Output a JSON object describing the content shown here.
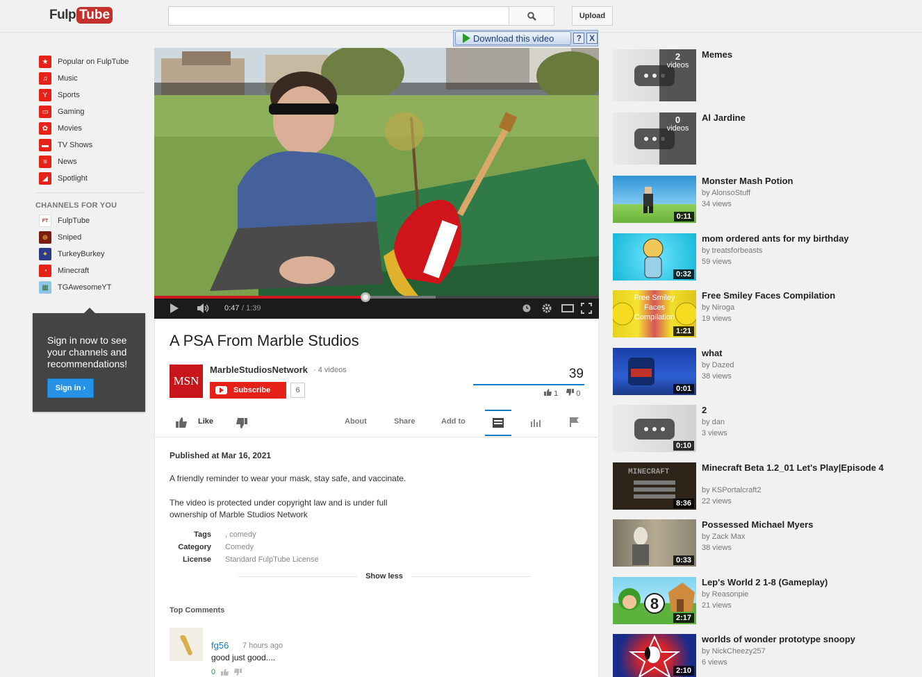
{
  "header": {
    "logo_left": "Fulp",
    "logo_right": "Tube",
    "search_placeholder": "",
    "upload_label": "Upload"
  },
  "download_bar": {
    "label": "Download this video",
    "help": "?",
    "close": "X"
  },
  "guide": {
    "items": [
      {
        "label": "Popular on FulpTube",
        "icon": "star-icon"
      },
      {
        "label": "Music",
        "icon": "headphones-icon"
      },
      {
        "label": "Sports",
        "icon": "trophy-icon"
      },
      {
        "label": "Gaming",
        "icon": "gamepad-icon"
      },
      {
        "label": "Movies",
        "icon": "film-reel-icon"
      },
      {
        "label": "TV Shows",
        "icon": "tv-icon"
      },
      {
        "label": "News",
        "icon": "newspaper-icon"
      },
      {
        "label": "Spotlight",
        "icon": "spotlight-icon"
      }
    ],
    "channels_heading": "CHANNELS FOR YOU",
    "channels": [
      {
        "label": "FulpTube"
      },
      {
        "label": "Sniped"
      },
      {
        "label": "TurkeyBurkey"
      },
      {
        "label": "Minecraft"
      },
      {
        "label": "TGAwesomeYT"
      }
    ],
    "signin_text": "Sign in now to see your channels and recommendations!",
    "signin_button": "Sign in ›"
  },
  "player": {
    "time_current": "0:47",
    "time_total": "/ 1:39",
    "progress_fraction": 0.475
  },
  "video": {
    "title": "A PSA From Marble Studios",
    "channel_initials": "MSN",
    "channel_name": "MarbleStudiosNetwork",
    "channel_video_count": "· 4 videos",
    "subscribe_label": "Subscribe",
    "subscriber_count": "6",
    "view_count": "39",
    "likes": "1",
    "dislikes": "0",
    "like_label": "Like",
    "tabs": [
      "About",
      "Share",
      "Add to"
    ],
    "published": "Published at Mar 16, 2021",
    "description_1": "A friendly reminder to wear your mask, stay safe, and vaccinate.",
    "description_2": "The video is protected under copyright law and is under full ownership of Marble Studios Network",
    "meta": [
      {
        "label": "Tags",
        "value": ", comedy"
      },
      {
        "label": "Category",
        "value": "Comedy"
      },
      {
        "label": "License",
        "value": "Standard FulpTube License"
      }
    ],
    "show_less": "Show less"
  },
  "comments": {
    "heading": "Top Comments",
    "items": [
      {
        "user": "fg56",
        "time": "7 hours ago",
        "text": "good just good....",
        "score": "0"
      }
    ]
  },
  "related": [
    {
      "title": "Memes",
      "playlist_count": "2",
      "playlist_label": "videos",
      "type": "playlist"
    },
    {
      "title": "Al Jardine",
      "playlist_count": "0",
      "playlist_label": "videos",
      "type": "playlist"
    },
    {
      "title": "Monster Mash Potion",
      "by": "by AlonsoStuff",
      "views": "34 views",
      "duration": "0:11"
    },
    {
      "title": "mom ordered ants for my birthday",
      "by": "by treatsforbeasts",
      "views": "59 views",
      "duration": "0:32"
    },
    {
      "title": "Free Smiley Faces Compilation",
      "by": "by Niroga",
      "views": "19 views",
      "duration": "1:21"
    },
    {
      "title": "what",
      "by": "by Dazed",
      "views": "38 views",
      "duration": "0:01"
    },
    {
      "title": "2",
      "by": "by dan",
      "views": "3 views",
      "duration": "0:10"
    },
    {
      "title": "Minecraft Beta 1.2_01 Let's Play|Episode 4",
      "by": "by KSPortalcraft2",
      "views": "22 views",
      "duration": "8:36"
    },
    {
      "title": "Possessed Michael Myers",
      "by": "by Zack Max",
      "views": "38 views",
      "duration": "0:33"
    },
    {
      "title": "Lep's World 2 1-8 (Gameplay)",
      "by": "by Reasonpie",
      "views": "21 views",
      "duration": "2:17"
    },
    {
      "title": "worlds of wonder prototype snoopy",
      "by": "by NickCheezy257",
      "views": "6 views",
      "duration": "2:10"
    }
  ]
}
